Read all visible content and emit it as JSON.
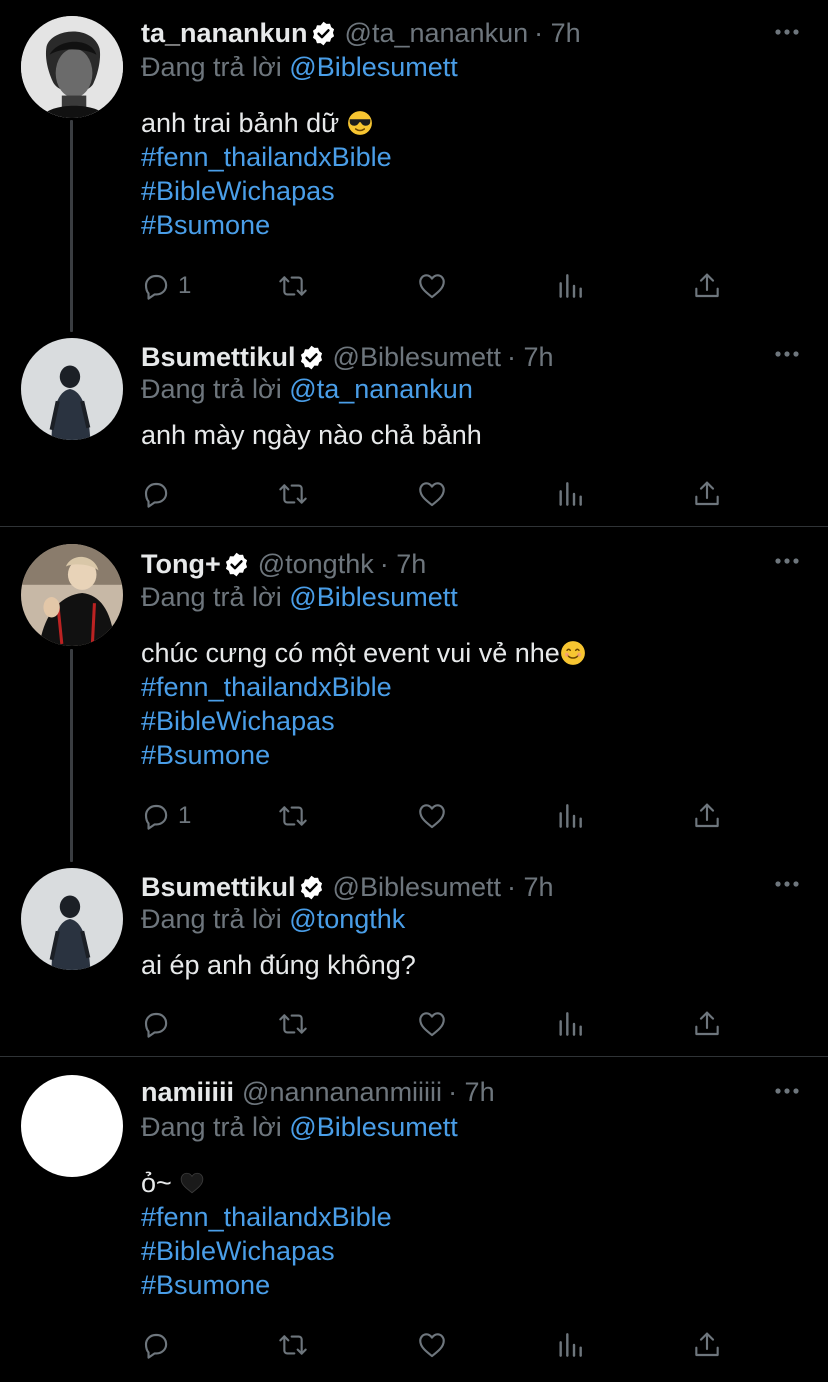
{
  "colors": {
    "background": "#000000",
    "text": "#e7e9ea",
    "muted": "#6e767d",
    "link": "#4a9ee8",
    "verified_badge": "#ffffff"
  },
  "icons": {
    "reply": "reply-icon",
    "retweet": "retweet-icon",
    "like": "heart-icon",
    "analytics": "analytics-icon",
    "share": "share-icon",
    "more": "more-icon",
    "verified": "verified-badge-icon"
  },
  "tweets": [
    {
      "name": "ta_nanankun",
      "handle": "@ta_nanankun",
      "time": "· 7h",
      "reply_prefix": "Đang trả lời",
      "reply_to": "@Biblesumett",
      "text": "anh trai bảnh dữ",
      "text_emoji": "smiling-face-with-sunglasses",
      "hashtags": [
        "#fenn_thailandxBible",
        "#BibleWichapas",
        "#Bsumone"
      ],
      "reply_count": "1"
    },
    {
      "name": "Bsumettikul",
      "handle": "@Biblesumett",
      "time": "· 7h",
      "reply_prefix": "Đang trả lời",
      "reply_to": "@ta_nanankun",
      "text": "anh mày ngày nào chả bảnh",
      "reply_count": ""
    },
    {
      "name": "Tong+",
      "handle": "@tongthk",
      "time": "· 7h",
      "reply_prefix": "Đang trả lời",
      "reply_to": "@Biblesumett",
      "text": "chúc cưng có một event vui vẻ nhe",
      "text_emoji": "smiling-face",
      "hashtags": [
        "#fenn_thailandxBible",
        "#BibleWichapas",
        "#Bsumone"
      ],
      "reply_count": "1"
    },
    {
      "name": "Bsumettikul",
      "handle": "@Biblesumett",
      "time": "· 7h",
      "reply_prefix": "Đang trả lời",
      "reply_to": "@tongthk",
      "text": "ai ép anh đúng không?",
      "reply_count": ""
    },
    {
      "name": "namiiiii",
      "handle": "@nannananmiiiii",
      "time": "· 7h",
      "reply_prefix": "Đang trả lời",
      "reply_to": "@Biblesumett",
      "text": "ỏ~",
      "text_emoji": "black-heart",
      "hashtags": [
        "#fenn_thailandxBible",
        "#BibleWichapas",
        "#Bsumone"
      ],
      "reply_count": ""
    }
  ]
}
